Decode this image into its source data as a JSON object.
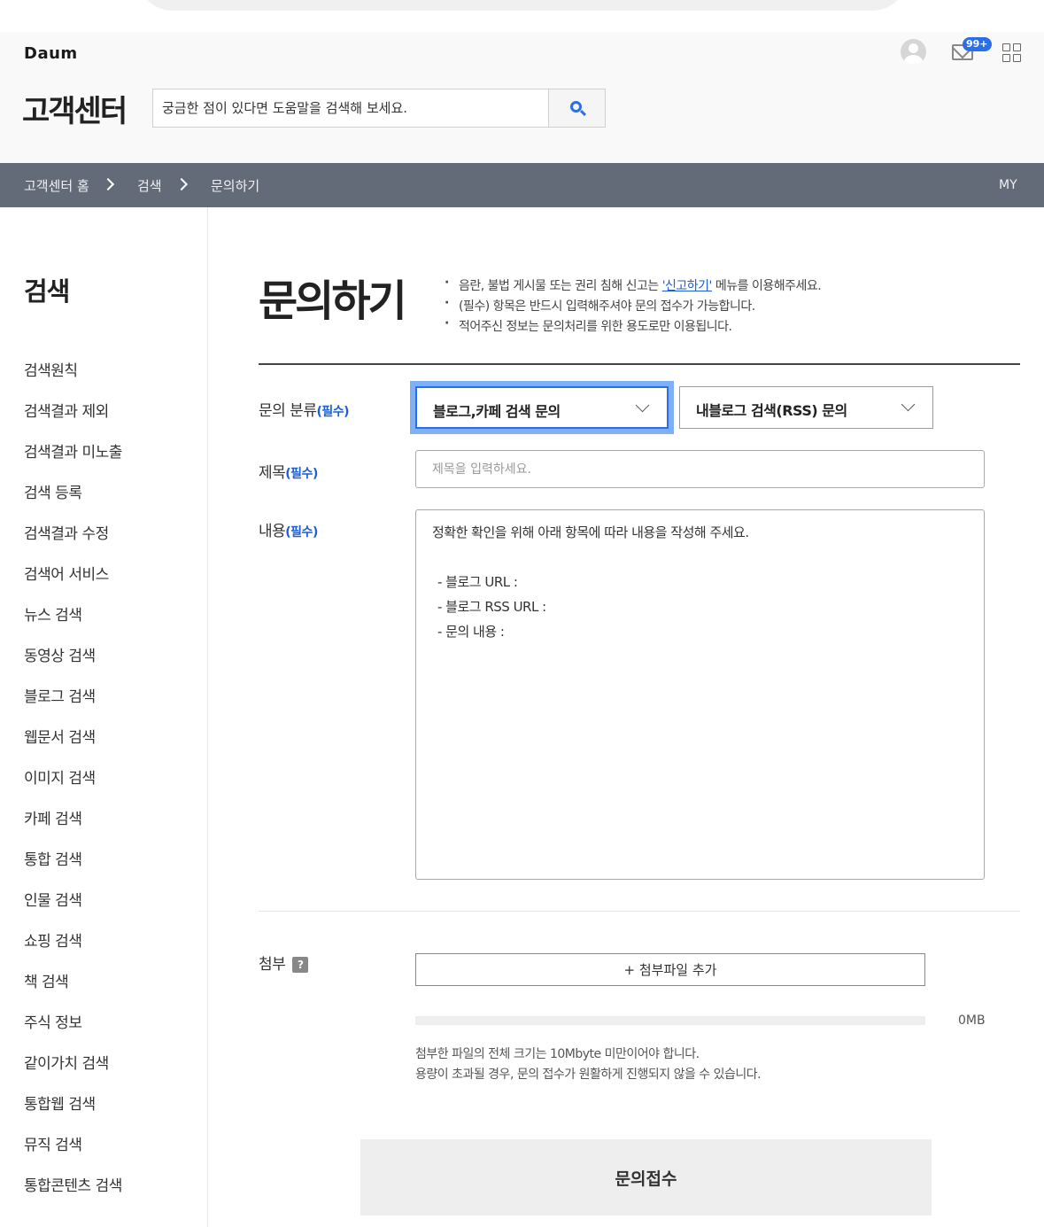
{
  "header": {
    "logo": "Daum",
    "notification_count": "99+",
    "title": "고객센터",
    "search_placeholder": "궁금한 점이 있다면 도움말을 검색해 보세요."
  },
  "breadcrumb": {
    "items": [
      "고객센터 홈",
      "검색",
      "문의하기"
    ],
    "my_label": "MY"
  },
  "sidebar": {
    "title": "검색",
    "items": [
      "검색원칙",
      "검색결과 제외",
      "검색결과 미노출",
      "검색 등록",
      "검색결과 수정",
      "검색어 서비스",
      "뉴스 검색",
      "동영상 검색",
      "블로그 검색",
      "웹문서 검색",
      "이미지 검색",
      "카페 검색",
      "통합 검색",
      "인물 검색",
      "쇼핑 검색",
      "책 검색",
      "주식 정보",
      "같이가치 검색",
      "통합웹 검색",
      "뮤직 검색",
      "통합콘텐츠 검색"
    ]
  },
  "main": {
    "title": "문의하기",
    "notes": {
      "n1_pre": "음란, 불법 게시물 또는 권리 침해 신고는 ",
      "n1_link": "'신고하기'",
      "n1_post": " 메뉴를 이용해주세요.",
      "n2": "(필수) 항목은 반드시 입력해주셔야 문의 접수가 가능합니다.",
      "n3": "적어주신 정보는 문의처리를 위한 용도로만 이용됩니다."
    },
    "required_mark": "(필수)",
    "category": {
      "label": "문의 분류",
      "primary": "블로그,카페 검색 문의",
      "secondary": "내블로그 검색(RSS) 문의"
    },
    "subject": {
      "label": "제목",
      "placeholder": "제목을 입력하세요."
    },
    "content": {
      "label": "내용",
      "intro": "정확한 확인을 위해 아래 항목에 따라 내용을 작성해 주세요.",
      "items": [
        "- 블로그 URL :",
        "- 블로그 RSS URL :",
        "- 문의 내용 :"
      ]
    },
    "attach": {
      "label": "첨부",
      "help_icon": "?",
      "button": "+ 첨부파일 추가",
      "size": "0MB",
      "usage_fraction": 0,
      "note1": "첨부한 파일의 전체 크기는 10Mbyte 미만이어야 합니다.",
      "note2": "용량이 초과될 경우, 문의 접수가 원활하게 진행되지 않을 수 있습니다."
    },
    "submit": "문의접수"
  },
  "colors": {
    "accent": "#2b6fe8",
    "breadcrumb_bg": "#646b78",
    "link": "#1a5fd4"
  },
  "icons": [
    "user-avatar-icon",
    "mail-icon",
    "app-grid-icon",
    "search-icon",
    "chevron-right-icon",
    "chevron-down-icon",
    "help-icon"
  ]
}
